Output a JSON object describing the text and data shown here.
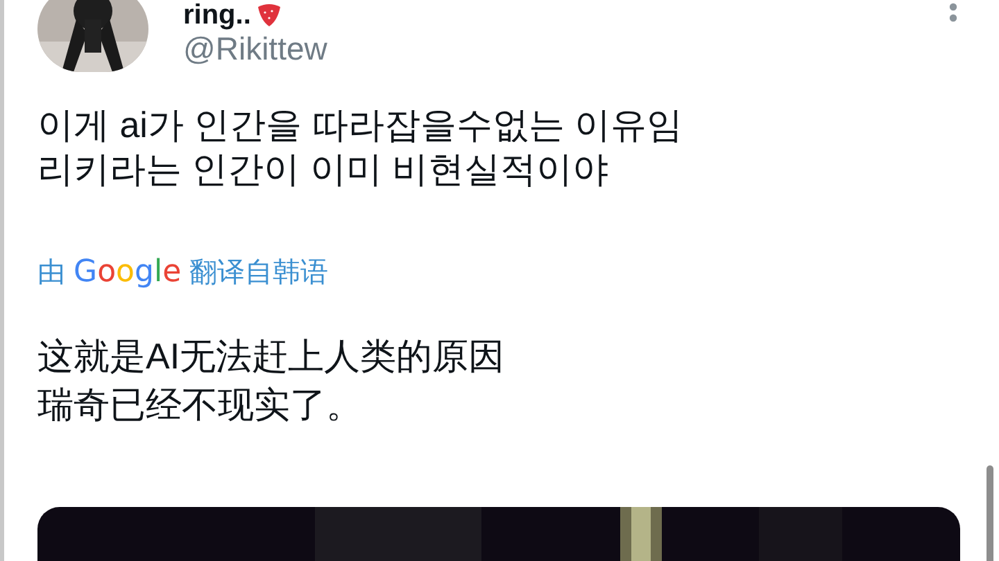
{
  "tweet": {
    "display_name": "ring..",
    "handle": "@Rikittew",
    "text_lines": [
      "이게 ai가 인간을 따라잡을수없는 이유임",
      "리키라는 인간이 이미 비현실적이야"
    ],
    "translation": {
      "prefix": "由",
      "brand": "Google",
      "label": "翻译自韩语"
    },
    "translated_lines": [
      "这就是AI无法赶上人类的原因",
      "瑞奇已经不现实了。"
    ]
  }
}
